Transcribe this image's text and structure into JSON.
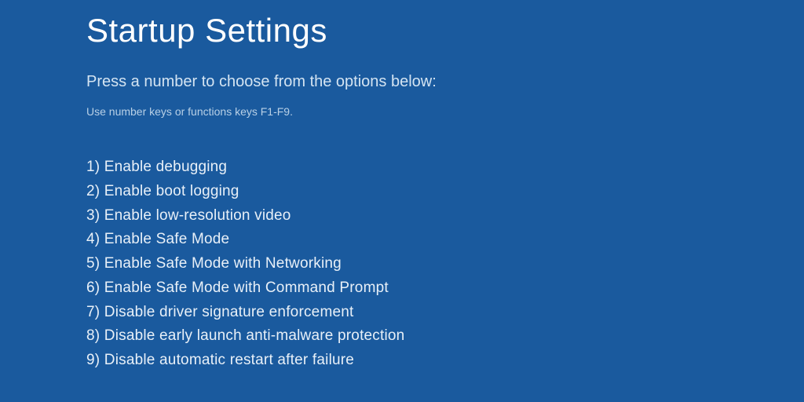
{
  "title": "Startup Settings",
  "instruction": "Press a number to choose from the options below:",
  "hint": "Use number keys or functions keys F1-F9.",
  "options": [
    {
      "num": "1",
      "label": "Enable debugging"
    },
    {
      "num": "2",
      "label": "Enable boot logging"
    },
    {
      "num": "3",
      "label": "Enable low-resolution video"
    },
    {
      "num": "4",
      "label": "Enable Safe Mode"
    },
    {
      "num": "5",
      "label": "Enable Safe Mode with Networking"
    },
    {
      "num": "6",
      "label": "Enable Safe Mode with Command Prompt"
    },
    {
      "num": "7",
      "label": "Disable driver signature enforcement"
    },
    {
      "num": "8",
      "label": "Disable early launch anti-malware protection"
    },
    {
      "num": "9",
      "label": "Disable automatic restart after failure"
    }
  ]
}
